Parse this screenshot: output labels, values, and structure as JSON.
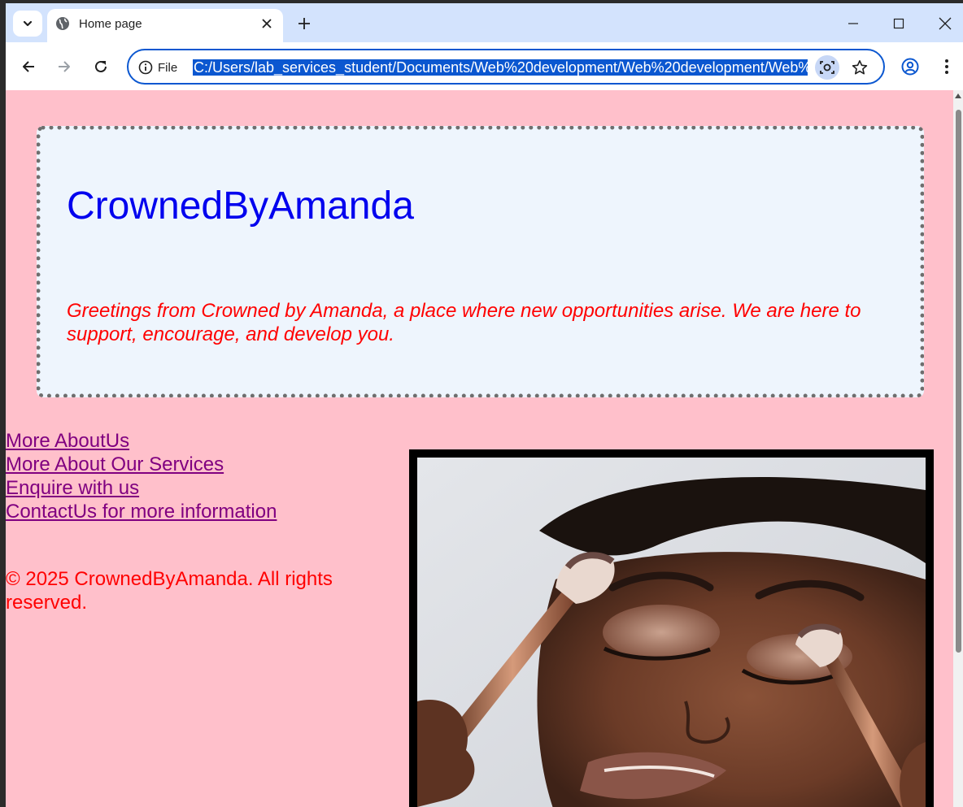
{
  "browser": {
    "tab_title": "Home page",
    "site_info_label": "File",
    "url": "C:/Users/lab_services_student/Documents/Web%20development/Web%20development/Web%20c",
    "icons": {
      "tab_search": "chevron-down-icon",
      "favicon": "globe-icon",
      "tab_close": "close-icon",
      "new_tab": "plus-icon",
      "minimize": "minimize-icon",
      "maximize": "maximize-icon",
      "close_window": "close-icon",
      "back": "arrow-left-icon",
      "forward": "arrow-right-icon",
      "reload": "reload-icon",
      "site_info": "info-icon",
      "lens": "camera-search-icon",
      "bookmark": "star-icon",
      "profile": "profile-icon",
      "menu": "more-vert-icon"
    }
  },
  "page": {
    "title": "CrownedByAmanda",
    "greeting": "Greetings from Crowned by Amanda, a place where new opportunities arise. We are here to support, encourage, and develop you.",
    "links": [
      {
        "label": "More AboutUs"
      },
      {
        "label": "More About Our Services"
      },
      {
        "label": "Enquire with us"
      },
      {
        "label": "ContactUs for more information"
      }
    ],
    "copyright": "© 2025 CrownedByAmanda. All rights reserved."
  },
  "colors": {
    "page_background": "#ffc0cb",
    "header_box_background": "#eef5fd",
    "title_color": "#0000ee",
    "greeting_color": "#ff0000",
    "link_color": "#800080",
    "copyright_color": "#ff0000",
    "chrome_accent": "#0b57d0"
  }
}
